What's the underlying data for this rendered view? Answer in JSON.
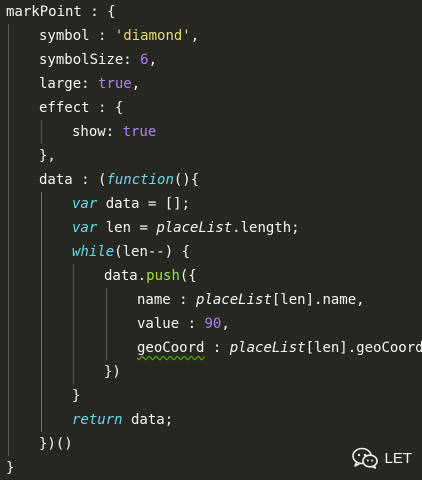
{
  "editor": {
    "theme": "monokai-like dark",
    "lines": [
      [
        {
          "t": "markPoint",
          "k": "prop"
        },
        {
          "t": " : {",
          "k": "punc"
        }
      ],
      [
        {
          "t": "symbol",
          "k": "prop"
        },
        {
          "t": " : ",
          "k": "punc"
        },
        {
          "t": "'diamond'",
          "k": "str"
        },
        {
          "t": ",",
          "k": "punc"
        }
      ],
      [
        {
          "t": "symbolSize",
          "k": "prop"
        },
        {
          "t": ": ",
          "k": "punc"
        },
        {
          "t": "6",
          "k": "num"
        },
        {
          "t": ",",
          "k": "punc"
        }
      ],
      [
        {
          "t": "large",
          "k": "prop"
        },
        {
          "t": ": ",
          "k": "punc"
        },
        {
          "t": "true",
          "k": "bool"
        },
        {
          "t": ",",
          "k": "punc"
        }
      ],
      [
        {
          "t": "effect",
          "k": "prop"
        },
        {
          "t": " : {",
          "k": "punc"
        }
      ],
      [
        {
          "t": "show",
          "k": "prop"
        },
        {
          "t": ": ",
          "k": "punc"
        },
        {
          "t": "true",
          "k": "bool"
        }
      ],
      [
        {
          "t": "},",
          "k": "punc"
        }
      ],
      [
        {
          "t": "data",
          "k": "prop"
        },
        {
          "t": " : (",
          "k": "punc"
        },
        {
          "t": "function",
          "k": "kw"
        },
        {
          "t": "(){",
          "k": "punc"
        }
      ],
      [
        {
          "t": "var",
          "k": "kw"
        },
        {
          "t": " data = [];",
          "k": "plain"
        }
      ],
      [
        {
          "t": "var",
          "k": "kw"
        },
        {
          "t": " len = ",
          "k": "plain"
        },
        {
          "t": "placeList",
          "k": "ivar"
        },
        {
          "t": ".length;",
          "k": "plain"
        }
      ],
      [
        {
          "t": "while",
          "k": "kw"
        },
        {
          "t": "(len--) {",
          "k": "plain"
        }
      ],
      [
        {
          "t": "data.",
          "k": "plain"
        },
        {
          "t": "push",
          "k": "fn"
        },
        {
          "t": "({",
          "k": "punc"
        }
      ],
      [
        {
          "t": "name",
          "k": "prop"
        },
        {
          "t": " : ",
          "k": "punc"
        },
        {
          "t": "placeList",
          "k": "ivar"
        },
        {
          "t": "[len].name,",
          "k": "plain"
        }
      ],
      [
        {
          "t": "value",
          "k": "prop"
        },
        {
          "t": " : ",
          "k": "punc"
        },
        {
          "t": "90",
          "k": "num"
        },
        {
          "t": ",",
          "k": "punc"
        }
      ],
      [
        {
          "t": "geoCoord",
          "k": "propsq"
        },
        {
          "t": " : ",
          "k": "punc"
        },
        {
          "t": "placeList",
          "k": "ivar"
        },
        {
          "t": "[len].geoCoord",
          "k": "plain"
        }
      ],
      [
        {
          "t": "})",
          "k": "punc"
        }
      ],
      [
        {
          "t": "}",
          "k": "punc"
        }
      ],
      [
        {
          "t": "return",
          "k": "kw"
        },
        {
          "t": " data;",
          "k": "plain"
        }
      ],
      [
        {
          "t": "})()",
          "k": "punc"
        }
      ],
      [
        {
          "t": "}",
          "k": "punc"
        }
      ]
    ]
  },
  "watermark": {
    "label": "LET",
    "icon": "wechat-icon"
  }
}
